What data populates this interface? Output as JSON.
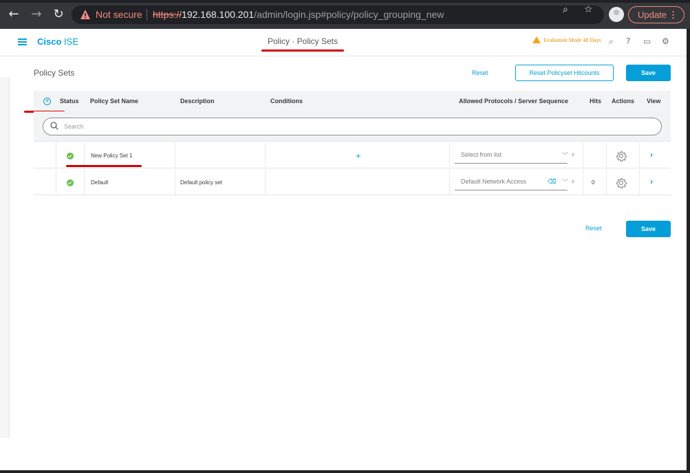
{
  "browser": {
    "security_label": "Not secure",
    "url_scheme": "https://",
    "url_host": "192.168.100.201",
    "url_path": "/admin/login.jsp#policy/policy_grouping_new",
    "update_label": "Update",
    "update_menu": "⋮"
  },
  "app": {
    "brand_bold": "Cisco",
    "brand_light": "ISE",
    "page_title": "Policy · Policy Sets",
    "eval_notice": "Evaluation Mode 48 Days",
    "accent_color": "#049fd9"
  },
  "toolbar": {
    "section_title": "Policy Sets",
    "reset_label": "Reset",
    "reset_hitcounts_label": "Reset Policyset Hitcounts",
    "save_label": "Save"
  },
  "table": {
    "columns": {
      "status": "Status",
      "name": "Policy Set Name",
      "description": "Description",
      "conditions": "Conditions",
      "protocols": "Allowed Protocols / Server Sequence",
      "hits": "Hits",
      "actions": "Actions",
      "view": "View"
    },
    "search_placeholder": "Search",
    "rows": [
      {
        "status": "enabled",
        "name": "New Policy Set 1",
        "description": "",
        "conditions_add": "+",
        "protocol": "Select from list",
        "protocol_clear": "",
        "hits": ""
      },
      {
        "status": "enabled",
        "name": "Default",
        "description": "Default policy set",
        "conditions_add": "",
        "protocol": "Default Network Access",
        "protocol_clear": "⌫",
        "hits": "0"
      }
    ]
  },
  "footer": {
    "reset_label": "Reset",
    "save_label": "Save"
  }
}
